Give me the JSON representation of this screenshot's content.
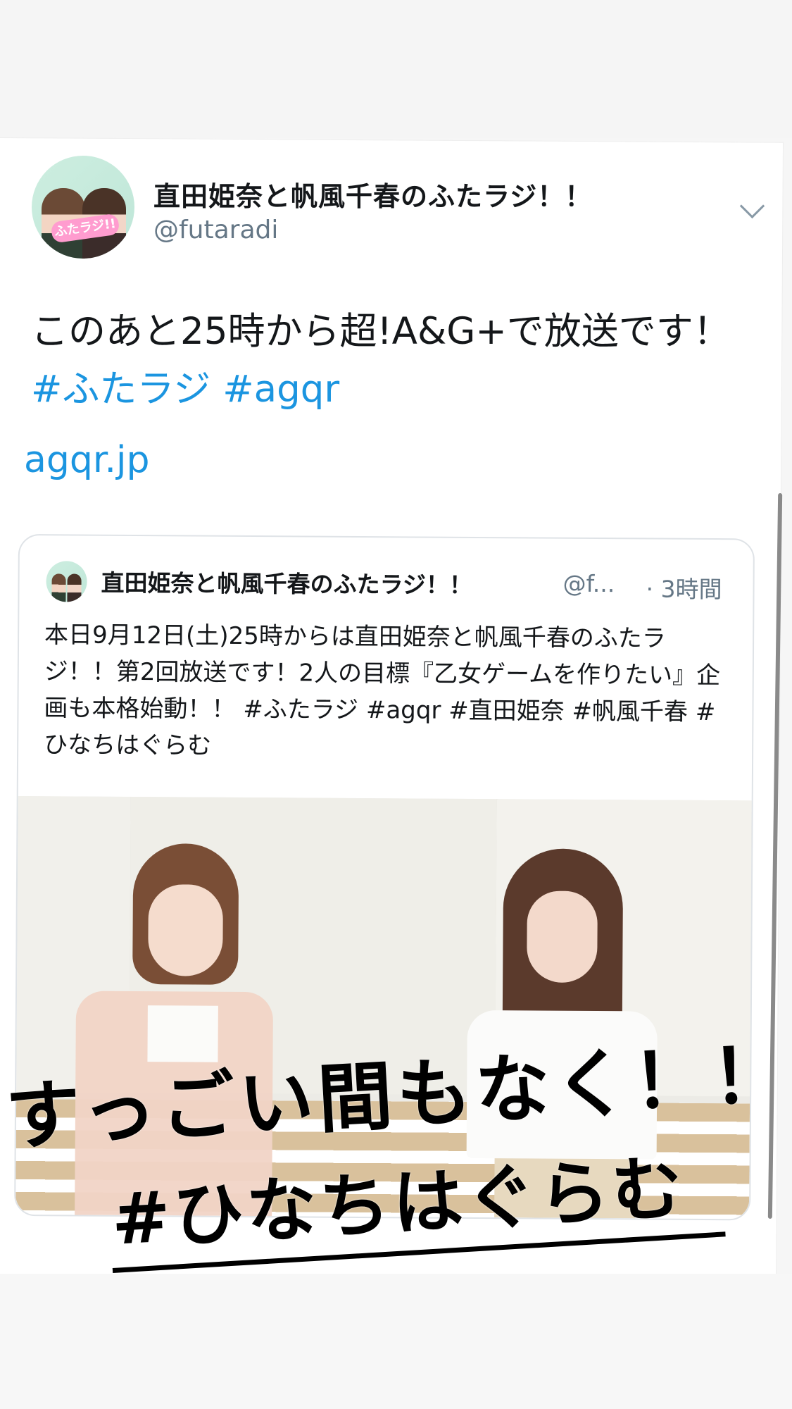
{
  "tweet": {
    "display_name": "直田姫奈と帆風千春のふたラジ！！",
    "handle": "@futaradi",
    "avatar_logo": "ふたラジ!!",
    "text_before": "このあと25時から超!A&G+で放送です！",
    "hashtags": [
      "#ふたラジ",
      "#agqr"
    ],
    "link": "agqr.jp"
  },
  "quote": {
    "display_name": "直田姫奈と帆風千春のふたラジ！！",
    "handle": "@f...",
    "time": "· 3時間",
    "text": "本日9月12日(土)25時からは直田姫奈と帆風千春のふたラジ！！第2回放送です！2人の目標『乙女ゲームを作りたい』企画も本格始動！！ #ふたラジ #agqr #直田姫奈 #帆風千春  #ひなちはぐらむ"
  },
  "overlay": {
    "line1": "すっごい間もなく！！",
    "line2": "#ひなちはぐらむ"
  },
  "icons": {
    "menu": "chevron-down-icon",
    "avatar": "profile-avatar"
  },
  "colors": {
    "link": "#1b95e0",
    "secondary_text": "#657786",
    "text": "#14171a"
  }
}
